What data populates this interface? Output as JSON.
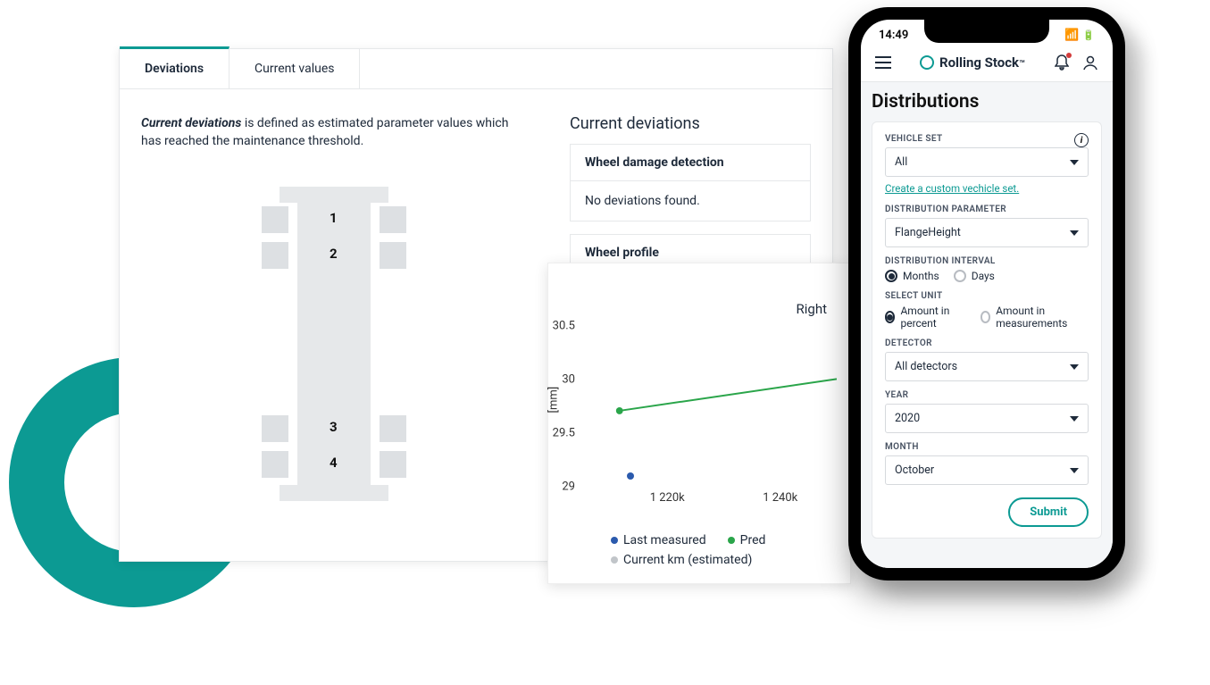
{
  "tabs": {
    "deviations": "Deviations",
    "current": "Current values"
  },
  "desc_b": "Current deviations",
  "desc_rest": " is defined as estimated parameter values which has reached the maintenance threshold.",
  "axles": {
    "a1": "1",
    "a2": "2",
    "a3": "3",
    "a4": "4"
  },
  "section_title": "Current deviations",
  "card1": {
    "head": "Wheel damage detection",
    "body": "No deviations found."
  },
  "card2": {
    "head": "Wheel profile"
  },
  "chart_data": {
    "type": "line",
    "title": "Right",
    "ylabel": "[mm]",
    "y_ticks": [
      "30.5",
      "30",
      "29.5",
      "29"
    ],
    "x_ticks": [
      "1 220k",
      "1 240k"
    ],
    "ylim": [
      29,
      30.5
    ],
    "series": [
      {
        "name": "Last measured",
        "color": "#2b5aad",
        "points": [
          {
            "x": 1220,
            "y": 29.1
          }
        ]
      },
      {
        "name": "Predicted",
        "color": "#2aa54a",
        "points": [
          {
            "x": 1220,
            "y": 29.7
          },
          {
            "x": 1260,
            "y": 30.0
          }
        ]
      },
      {
        "name": "Current km (estimated)",
        "color": "#c1c5c9"
      }
    ],
    "legend": {
      "measured": "Last measured",
      "predicted": "Pred",
      "current_km": "Current km (estimated)"
    }
  },
  "phone": {
    "time": "14:49",
    "brand": "Rolling Stock",
    "brand_tm": "™",
    "page_title": "Distributions",
    "vehicle_set": {
      "label": "VEHICLE SET",
      "value": "All",
      "link": "Create a custom vechicle set."
    },
    "dist_param": {
      "label": "DISTRIBUTION PARAMETER",
      "value": "FlangeHeight"
    },
    "dist_interval": {
      "label": "DISTRIBUTION INTERVAL",
      "months": "Months",
      "days": "Days"
    },
    "unit": {
      "label": "SELECT UNIT",
      "percent": "Amount in percent",
      "measurements": "Amount in measurements"
    },
    "detector": {
      "label": "DETECTOR",
      "value": "All detectors"
    },
    "year": {
      "label": "YEAR",
      "value": "2020"
    },
    "month": {
      "label": "MONTH",
      "value": "October"
    },
    "submit": "Submit"
  }
}
